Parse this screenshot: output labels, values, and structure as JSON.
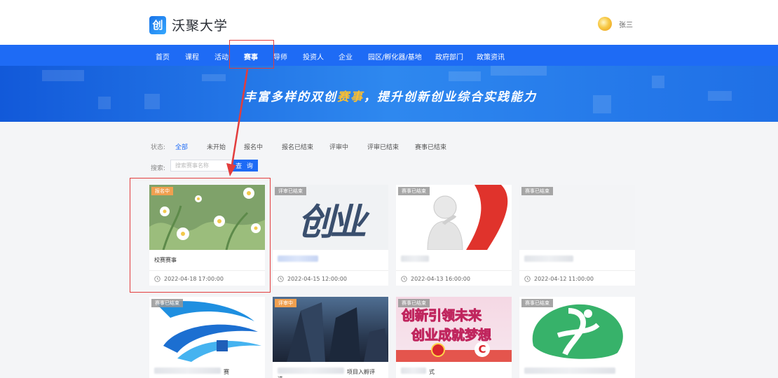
{
  "app": {
    "logo_mark": "创",
    "name": "沃聚大学"
  },
  "user": {
    "name": "张三"
  },
  "nav": {
    "items": [
      {
        "label": "首页"
      },
      {
        "label": "课程"
      },
      {
        "label": "活动"
      },
      {
        "label": "赛事",
        "active": true
      },
      {
        "label": "导师"
      },
      {
        "label": "投资人"
      },
      {
        "label": "企业"
      },
      {
        "label": "园区/孵化器/基地"
      },
      {
        "label": "政府部门"
      },
      {
        "label": "政策资讯"
      }
    ]
  },
  "banner": {
    "title_before": "丰富多样的双创",
    "title_highlight": "赛事",
    "title_after": "，提升创新创业综合实践能力"
  },
  "filters": {
    "status_label": "状态:",
    "options": [
      "全部",
      "未开始",
      "报名中",
      "报名已结束",
      "评审中",
      "评审已结束",
      "赛事已结束"
    ],
    "active": "全部"
  },
  "search": {
    "label": "搜索:",
    "placeholder": "搜索赛事名称",
    "button": "查 询"
  },
  "cards": [
    {
      "badge": "报名中",
      "title": "校赛赛事",
      "date": "2022-04-18 17:00:00",
      "thumb": "flowers"
    },
    {
      "badge": "评审已结束",
      "title": "",
      "date": "2022-04-15 12:00:00",
      "thumb": "chuangye"
    },
    {
      "badge": "赛事已结束",
      "title": "",
      "date": "2022-04-13 16:00:00",
      "thumb": "thinker"
    },
    {
      "badge": "赛事已结束",
      "title": "",
      "date": "2022-04-12 11:00:00",
      "thumb": "empty"
    },
    {
      "badge": "赛事已结束",
      "title": "",
      "title_tail": "赛",
      "thumb": "swirl"
    },
    {
      "badge": "评审中",
      "title": "",
      "title_tail": "项目入孵评",
      "title_line2": "选",
      "thumb": "tower"
    },
    {
      "badge": "赛事已结束",
      "title": "",
      "title_tail": "式",
      "thumb": "poster"
    },
    {
      "badge": "赛事已结束",
      "title": "",
      "thumb": "green"
    }
  ],
  "thumb_text": {
    "chuangye": "创业",
    "poster_line1": "创新引领未来",
    "poster_line2": "创业成就梦想",
    "poster_logo": "C"
  },
  "colors": {
    "primary": "#1e6bf5",
    "highlight": "#ffbf2e",
    "annotation": "#e23d3d"
  }
}
